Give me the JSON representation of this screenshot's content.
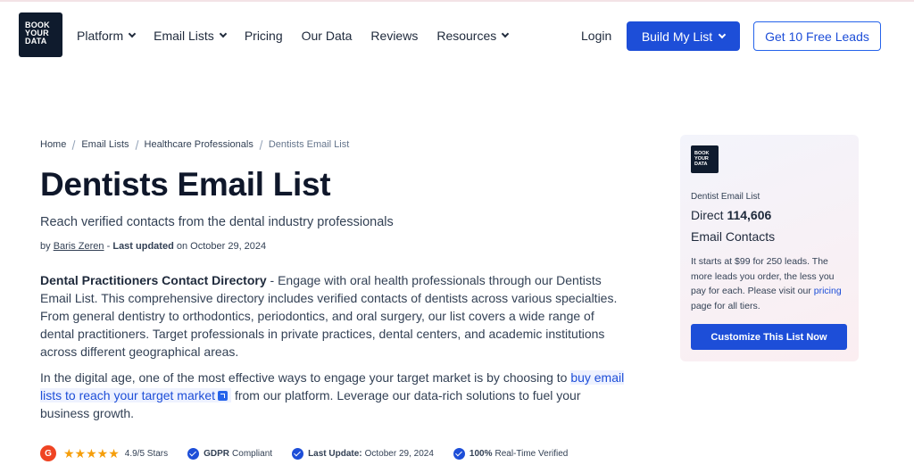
{
  "brand": {
    "logo_lines": [
      "BOOK",
      "YOUR",
      "DATA"
    ]
  },
  "nav": {
    "items": [
      {
        "label": "Platform",
        "has_dropdown": true
      },
      {
        "label": "Email Lists",
        "has_dropdown": true
      },
      {
        "label": "Pricing",
        "has_dropdown": false
      },
      {
        "label": "Our Data",
        "has_dropdown": false
      },
      {
        "label": "Reviews",
        "has_dropdown": false
      },
      {
        "label": "Resources",
        "has_dropdown": true
      }
    ],
    "login": "Login",
    "build_button": "Build My List",
    "leads_button": "Get 10 Free Leads"
  },
  "breadcrumb": [
    "Home",
    "Email Lists",
    "Healthcare Professionals",
    "Dentists Email List"
  ],
  "page": {
    "title": "Dentists Email List",
    "subtitle": "Reach verified contacts from the dental industry professionals",
    "byline_prefix": "by",
    "author": "Baris Zeren",
    "updated_label": "Last updated",
    "updated_date": "on October 29, 2024",
    "para1_lead": "Dental Practitioners Contact Directory",
    "para1_text": " - Engage with oral health professionals through our Dentists Email List. This comprehensive directory includes verified contacts of dentists across various specialties. From general dentistry to orthodontics, periodontics, and oral surgery, our list covers a wide range of dental practitioners. Target professionals in private practices, dental centers, and academic institutions across different geographical areas.",
    "para2_before": "In the digital age, one of the most effective ways to engage your target market is by choosing to ",
    "para2_link": "buy email lists to reach your target market",
    "para2_after": " from our platform. Leverage our data-rich solutions to fuel your business growth."
  },
  "trust": {
    "g2_logo": "G",
    "stars": "★★★★★",
    "rating": "4.9/5 Stars",
    "gdpr_bold": "GDPR",
    "gdpr_text": "Compliant",
    "update_bold": "Last Update:",
    "update_text": "October 29, 2024",
    "verified_bold": "100%",
    "verified_text": "Real-Time Verified"
  },
  "card": {
    "logo_lines": [
      "BOOK",
      "YOUR",
      "DATA"
    ],
    "kicker": "Dentist Email List",
    "direct_label": "Direct",
    "count": "114,606",
    "contacts_label": "Email Contacts",
    "desc_before": "It starts at $99 for 250 leads. The more leads you order, the less you pay for each. Please visit our ",
    "desc_link": "pricing",
    "desc_after": " page for all tiers.",
    "button": "Customize This List Now"
  },
  "colors": {
    "primary": "#1d4ed8",
    "dark": "#0f1b2d",
    "star": "#f59e0b",
    "g2": "#ef4423"
  }
}
